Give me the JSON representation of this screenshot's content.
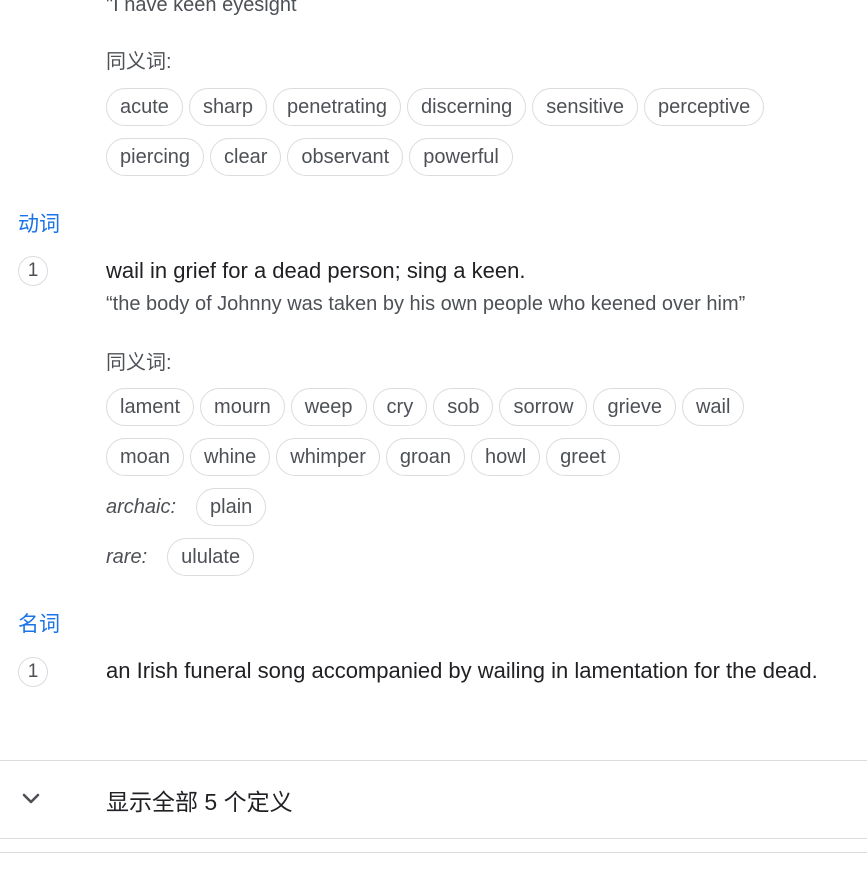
{
  "adjective_sense": {
    "example": "\"I have keen eyesight",
    "synonyms_label": "同义词:",
    "synonyms_row1": [
      "acute",
      "sharp",
      "penetrating",
      "discerning",
      "sensitive",
      "perceptive"
    ],
    "synonyms_row2": [
      "piercing",
      "clear",
      "observant",
      "powerful"
    ]
  },
  "verb_section": {
    "pos_label": "动词",
    "sense": {
      "number": "1",
      "definition": "wail in grief for a dead person; sing a keen.",
      "example": "“the body of Johnny was taken by his own people who keened over him”",
      "synonyms_label": "同义词:",
      "synonyms_row1": [
        "lament",
        "mourn",
        "weep",
        "cry",
        "sob",
        "sorrow",
        "grieve",
        "wail"
      ],
      "synonyms_row2": [
        "moan",
        "whine",
        "whimper",
        "groan",
        "howl",
        "greet"
      ],
      "archaic_label": "archaic:",
      "archaic_synonyms": [
        "plain"
      ],
      "rare_label": "rare:",
      "rare_synonyms": [
        "ululate"
      ]
    }
  },
  "noun_section": {
    "pos_label": "名词",
    "sense": {
      "number": "1",
      "definition": "an Irish funeral song accompanied by wailing in lamentation for the dead."
    }
  },
  "expand": {
    "icon": "chevron-down-icon",
    "label": "显示全部 5 个定义"
  }
}
